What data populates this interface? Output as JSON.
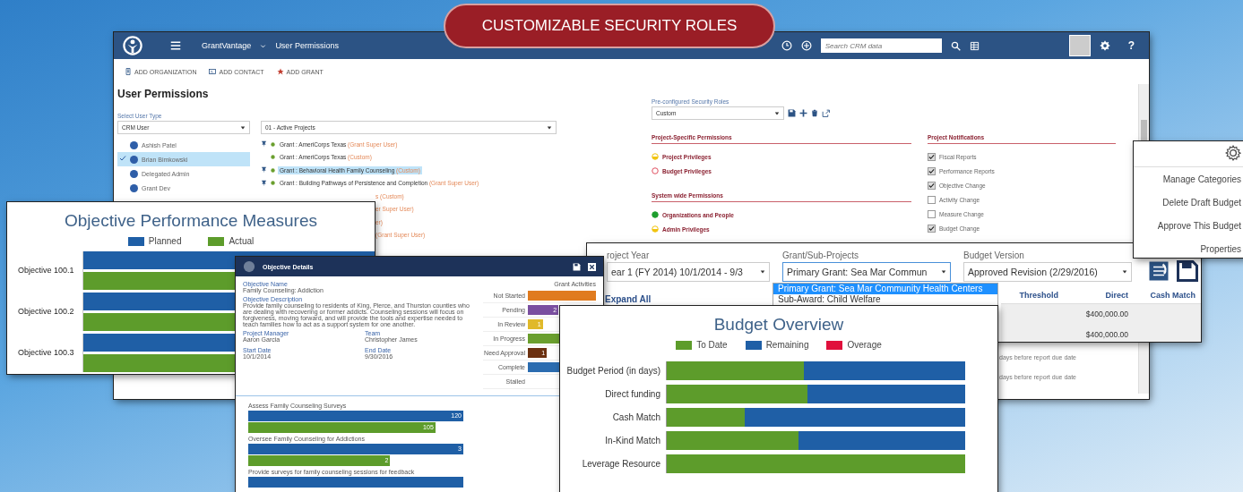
{
  "banner": {
    "title": "CUSTOMIZABLE SECURITY ROLES"
  },
  "main_window": {
    "app_name": "GrantVantage",
    "page": "User Permissions",
    "search": {
      "placeholder": "Search CRM data"
    },
    "help": "?",
    "toolbar": [
      "ADD ORGANIZATION",
      "ADD CONTACT",
      "ADD GRANT"
    ],
    "title": "User Permissions",
    "user_type": {
      "label": "Select User Type",
      "value": "CRM User"
    },
    "users": [
      {
        "name": "Ashish Patel",
        "selected": false
      },
      {
        "name": "Brian Bimkowski",
        "selected": true
      },
      {
        "name": "Delegated Admin",
        "selected": false
      },
      {
        "name": "Grant Dev",
        "selected": false
      }
    ],
    "project_filter": {
      "value": "01 - Active Projects"
    },
    "projects": [
      {
        "name": "Grant : AmeriCorps Texas",
        "role": "(Grant Super User)",
        "pinned": true,
        "selected": false
      },
      {
        "name": "Grant : AmeriCorps Texas",
        "role": "(Custom)",
        "pinned": false,
        "selected": false
      },
      {
        "name": "Grant : Behavioral Health Family Counseling",
        "role": "(Custom)",
        "pinned": true,
        "selected": true
      },
      {
        "name": "Grant : Building Pathways of Persistence and Completion",
        "role": "(Grant Super User)",
        "pinned": true,
        "selected": false
      }
    ],
    "covered_project_roles": [
      "s (Custom)",
      "er Super User)",
      "er)",
      "(Grant Super User)"
    ],
    "security_roles": {
      "label": "Pre-configured Security Roles",
      "value": "Custom"
    },
    "permission_groups": [
      {
        "title": "Project-Specific Permissions",
        "items": [
          {
            "name": "Project Privileges",
            "kind": "partial"
          },
          {
            "name": "Budget Privileges",
            "kind": "none"
          }
        ]
      },
      {
        "title": "System wide Permissions",
        "items": [
          {
            "name": "Organizations and People",
            "kind": "full"
          },
          {
            "name": "Admin Privileges",
            "kind": "partial"
          }
        ]
      }
    ],
    "notifications": {
      "title": "Project Notifications",
      "items": [
        {
          "label": "Fiscal Reports",
          "checked": true
        },
        {
          "label": "Performance Reports",
          "checked": true
        },
        {
          "label": "Objective Change",
          "checked": true
        },
        {
          "label": "Activity Change",
          "checked": false
        },
        {
          "label": "Measure Change",
          "checked": false
        },
        {
          "label": "Budget Change",
          "checked": true
        }
      ]
    },
    "footnotes": [
      "days before report due date",
      "days before report due date"
    ]
  },
  "settings_menu": {
    "items": [
      "Manage Categories",
      "Delete Draft Budget",
      "Approve This Budget",
      "Properties"
    ]
  },
  "performance_window": {
    "title": "Objective Performance Measures",
    "legend": [
      {
        "label": "Planned",
        "color": "#1f5fa6"
      },
      {
        "label": "Actual",
        "color": "#5d9c2b"
      }
    ],
    "objectives": [
      "Objective 100.1",
      "Objective 100.2",
      "Objective 100.3"
    ]
  },
  "budget_window": {
    "project_year": {
      "label": "roject Year",
      "value": "ear 1 (FY 2014) 10/1/2014 - 9/3"
    },
    "grant": {
      "label": "Grant/Sub-Projects",
      "value": "Primary Grant: Sea Mar Commun",
      "options": [
        {
          "label": "Primary Grant: Sea Mar Community Health Centers",
          "selected": true
        },
        {
          "label": "Sub-Award: Child Welfare",
          "selected": false
        }
      ]
    },
    "budget_version": {
      "label": "Budget Version",
      "value": "Approved Revision (2/29/2016)"
    },
    "expand_all": "Expand All",
    "table": {
      "columns": [
        "Threshold",
        "Direct",
        "Cash Match"
      ],
      "rows": [
        [
          "",
          "$400,000.00",
          ""
        ],
        [
          "",
          "$400,000.00",
          ""
        ]
      ]
    }
  },
  "details_window": {
    "title": "Objective Details",
    "fields": [
      {
        "label": "Objective Name",
        "value": "Family Counseling: Addiction"
      },
      {
        "label": "Objective Description",
        "value": "Provide family counseling to residents of King, Pierce, and Thurston counties who are dealing with recovering or former addicts. Counseling sessions will focus on forgiveness, moving forward, and will provide the tools and expertise needed to teach families how to act as a support system for one another."
      }
    ],
    "pairs": [
      {
        "label": "Project Manager",
        "value": "Aaron Garcia"
      },
      {
        "label": "Team",
        "value": "Christopher James"
      },
      {
        "label": "Start Date",
        "value": "10/1/2014"
      },
      {
        "label": "End Date",
        "value": "9/30/2016"
      }
    ],
    "activities": {
      "title": "Grant Activities",
      "rows": [
        {
          "label": "Not Started",
          "color": "#e07b1f"
        },
        {
          "label": "Pending",
          "color": "#7a4fa0",
          "value": "2"
        },
        {
          "label": "In Review",
          "color": "#e0b92a",
          "value": "1"
        },
        {
          "label": "In Progress",
          "color": "#6a9f2e"
        },
        {
          "label": "Need Approval",
          "color": "#6b3010",
          "value": "1"
        },
        {
          "label": "Complete",
          "color": "#2b6cb0"
        },
        {
          "label": "Stalled"
        }
      ]
    },
    "measures": [
      {
        "title": "Assess Family Counseling Surveys",
        "planned": "120",
        "actual": "105"
      },
      {
        "title": "Oversee Family Counseling for Addictions",
        "planned": "3",
        "actual": "2"
      },
      {
        "title": "Provide surveys for family counseling sessions for feedback"
      }
    ]
  },
  "overview_window": {
    "title": "Budget Overview",
    "legend": [
      {
        "label": "To Date",
        "color": "#5d9c2b"
      },
      {
        "label": "Remaining",
        "color": "#1f5fa6"
      },
      {
        "label": "Overage",
        "color": "#e0103c"
      }
    ],
    "categories": [
      "Budget Period (in days)",
      "Direct funding",
      "Cash Match",
      "In-Kind Match",
      "Leverage Resource"
    ]
  }
}
